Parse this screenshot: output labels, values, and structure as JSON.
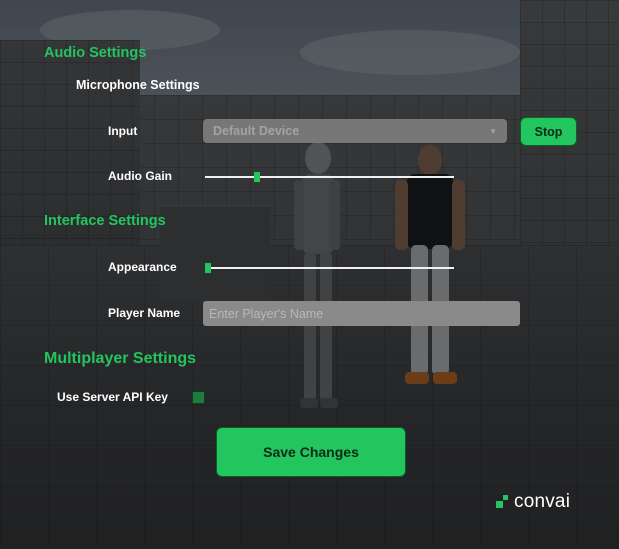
{
  "audio_settings": {
    "title": "Audio Settings",
    "microphone_title": "Microphone Settings",
    "input_label": "Input",
    "input_device": "Default Device",
    "stop_label": "Stop",
    "audio_gain_label": "Audio Gain",
    "audio_gain_level": 0.2
  },
  "interface_settings": {
    "title": "Interface Settings",
    "appearance_label": "Appearance",
    "appearance_level": 0.0,
    "player_name_label": "Player Name",
    "player_name_placeholder": "Enter Player's Name",
    "player_name_value": ""
  },
  "multiplayer_settings": {
    "title": "Multiplayer Settings",
    "use_server_api_key_label": "Use Server API Key",
    "use_server_api_key_checked": true
  },
  "save_label": "Save Changes",
  "logo_text": "convai",
  "colors": {
    "accent": "#22c55e",
    "dropdown_bg": "#7b7b7b",
    "input_bg": "#8a8a8a"
  },
  "icons": {
    "dropdown": "chevron-down-icon",
    "logo": "convai-logo-icon"
  }
}
